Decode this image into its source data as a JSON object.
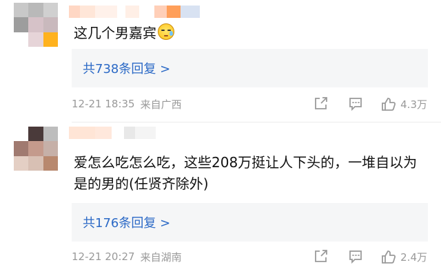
{
  "comments": [
    {
      "text": "这几个男嘉宾",
      "emoji_icon": "crying-face-icon",
      "reply_link": "共738条回复 >",
      "time": "12-21 18:35",
      "location": "来自广西",
      "like_count": "4.3万"
    },
    {
      "text": "爱怎么吃怎么吃，这些208万挺让人下头的，一堆自以为是的男的(任贤齐除外)",
      "reply_link": "共176条回复 >",
      "time": "12-21 20:27",
      "location": "来自湖南",
      "like_count": "2.4万"
    }
  ],
  "colors": {
    "link": "#2b69c6",
    "meta": "#999999",
    "reply_bg": "#f5f6f7"
  }
}
